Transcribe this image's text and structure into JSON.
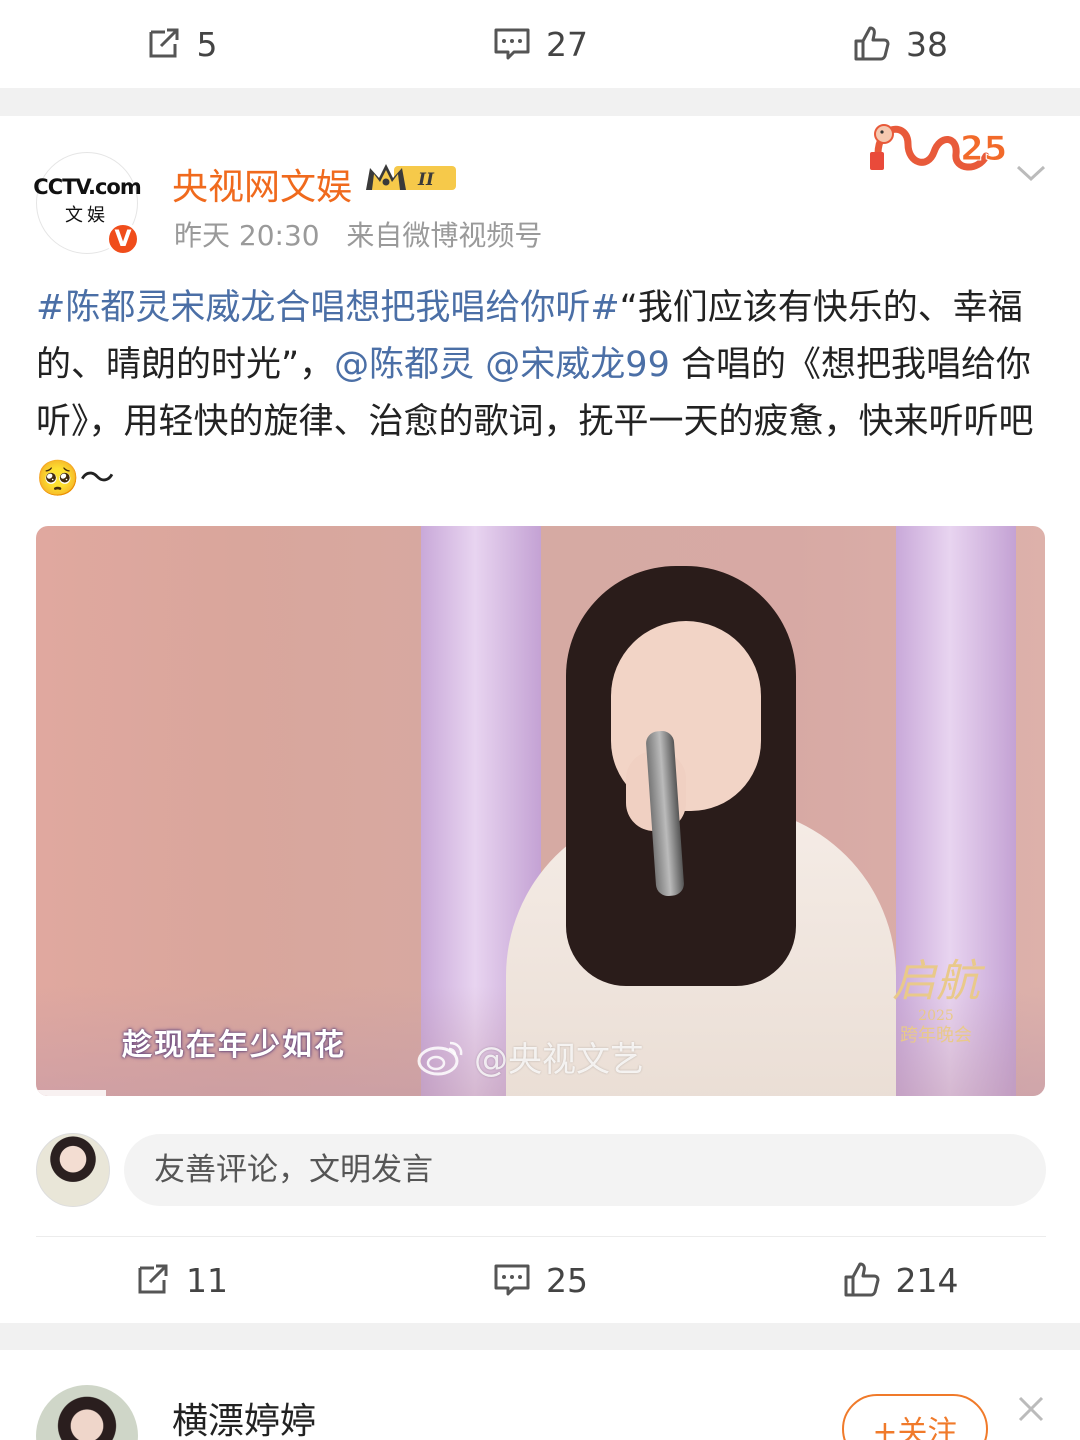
{
  "prev_post": {
    "repost_count": "5",
    "comment_count": "27",
    "like_count": "38"
  },
  "post": {
    "author": "央视网文娱",
    "avatar_logo": "CCTV.com",
    "avatar_sub": "文娱",
    "verified_mark": "V",
    "level_badge": "II",
    "time": "昨天 20:30",
    "source_prefix": "来自",
    "source": "微博视频号",
    "text": {
      "hashtag": "#陈都灵宋威龙合唱想把我唱给你听#",
      "part1": "“我们应该有快乐的、幸福的、晴朗的时光”，",
      "mention1": "@陈都灵",
      "space": " ",
      "mention2": "@宋威龙99",
      "part2": " 合唱的《想把我唱给你听》，用轻快的旋律、治愈的歌词，抚平一天的疲惫，快来听听吧",
      "emoji": "🥺",
      "tail": "～"
    },
    "video": {
      "subtitle": "趁现在年少如花",
      "watermark": "@央视文艺",
      "gala_title": "启航",
      "gala_year": "2025",
      "gala_name": "跨年晚会"
    },
    "comment_placeholder": "友善评论，文明发言",
    "repost_count": "11",
    "comment_count": "25",
    "like_count": "214"
  },
  "next_post": {
    "author": "横漂婷婷",
    "follow_label": "+关注"
  },
  "colors": {
    "author_orange": "#f06a1d",
    "link_blue": "#4b6fa6",
    "verified_red": "#f04d1b"
  }
}
